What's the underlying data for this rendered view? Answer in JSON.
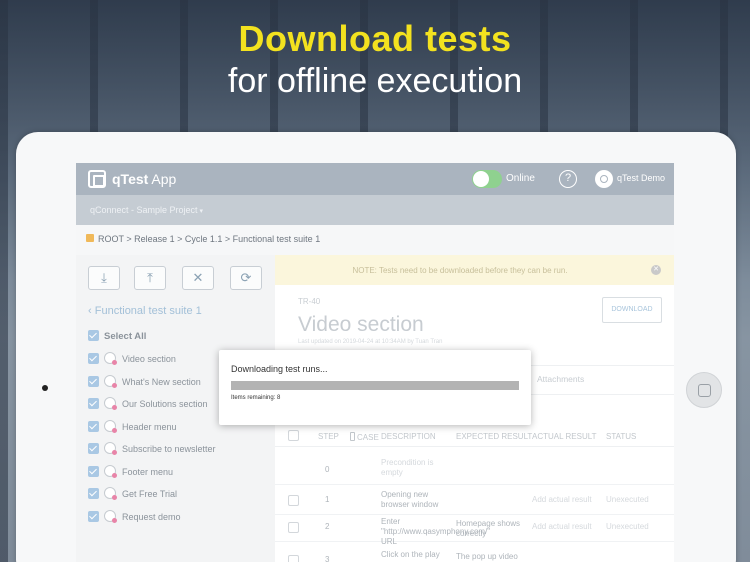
{
  "promo": {
    "headline": "Download tests",
    "subline": "for offline execution"
  },
  "app": {
    "brand_bold": "qTest",
    "brand_light": " App",
    "online_label": "Online",
    "online": true,
    "help_label": "?",
    "user_name": "qTest Demo",
    "project_name": "qConnect - Sample Project"
  },
  "breadcrumb": {
    "text": "ROOT > Release 1 > Cycle 1.1 > Functional test suite 1"
  },
  "toolbar": {
    "download_glyph": "⤓",
    "upload_glyph": "⤒",
    "delete_glyph": "✕",
    "sync_glyph": "⟳"
  },
  "sidebar": {
    "suite_title": "Functional test suite 1",
    "select_all": "Select All",
    "items": [
      {
        "label": "Video section"
      },
      {
        "label": "What's New section"
      },
      {
        "label": "Our Solutions section"
      },
      {
        "label": "Header menu"
      },
      {
        "label": "Subscribe to newsletter"
      },
      {
        "label": "Footer menu"
      },
      {
        "label": "Get Free Trial"
      },
      {
        "label": "Request demo"
      }
    ]
  },
  "notice": {
    "text": "NOTE: Tests need to be downloaded before they can be run.",
    "close": "✕"
  },
  "detail": {
    "id": "TR-40",
    "title": "Video section",
    "meta": "Last updated on 2019-04-24 at 10:34AM by Tuan Tran",
    "download_label": "DOWNLOAD",
    "tab_attachments": "Attachments"
  },
  "grid": {
    "headers": {
      "step": "STEP",
      "case": "CASE",
      "description": "DESCRIPTION",
      "expected": "EXPECTED RESULT",
      "actual": "ACTUAL RESULT",
      "status": "STATUS"
    },
    "rows": [
      {
        "step": "0",
        "description": "Precondition is empty",
        "expected": "",
        "actual": "",
        "status": ""
      },
      {
        "step": "1",
        "description": "Opening new browser window",
        "expected": "",
        "actual": "Add actual result",
        "status": "Unexecuted"
      },
      {
        "step": "2",
        "description": "Enter \"http://www.qasymphony.com/\" URL",
        "expected": "Homepage shows correctly",
        "actual": "Add actual result",
        "status": "Unexecuted"
      },
      {
        "step": "3",
        "description": "Click on the play",
        "expected": "The pop up video",
        "actual": "",
        "status": ""
      }
    ]
  },
  "modal": {
    "title": "Downloading test runs...",
    "progress": 1.0,
    "remaining": "Items remaining: 8"
  },
  "colors": {
    "headline": "#f3e21f",
    "accent": "#a3c0d8",
    "topbar": "#aab4bf"
  }
}
